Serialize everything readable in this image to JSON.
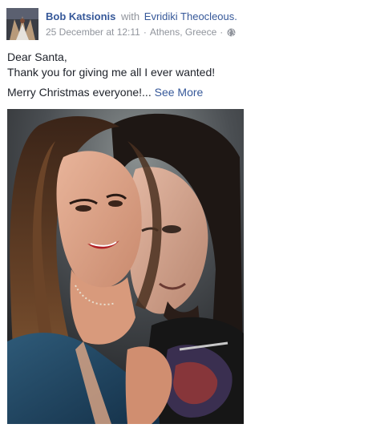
{
  "post": {
    "author": "Bob Katsionis",
    "with_word": "with",
    "tagged": "Evridiki Theocleous.",
    "timestamp": "25 December at 12:11",
    "separator": "·",
    "location": "Athens, Greece",
    "privacy_icon": "globe-icon",
    "text_lines": [
      "Dear Santa,",
      "Thank you for giving me all I ever wanted!"
    ],
    "text_line_3": "Merry Christmas everyone!",
    "ellipsis": "...",
    "see_more": "See More"
  },
  "colors": {
    "link": "#365899",
    "meta": "#90949c",
    "text": "#1d2129"
  }
}
